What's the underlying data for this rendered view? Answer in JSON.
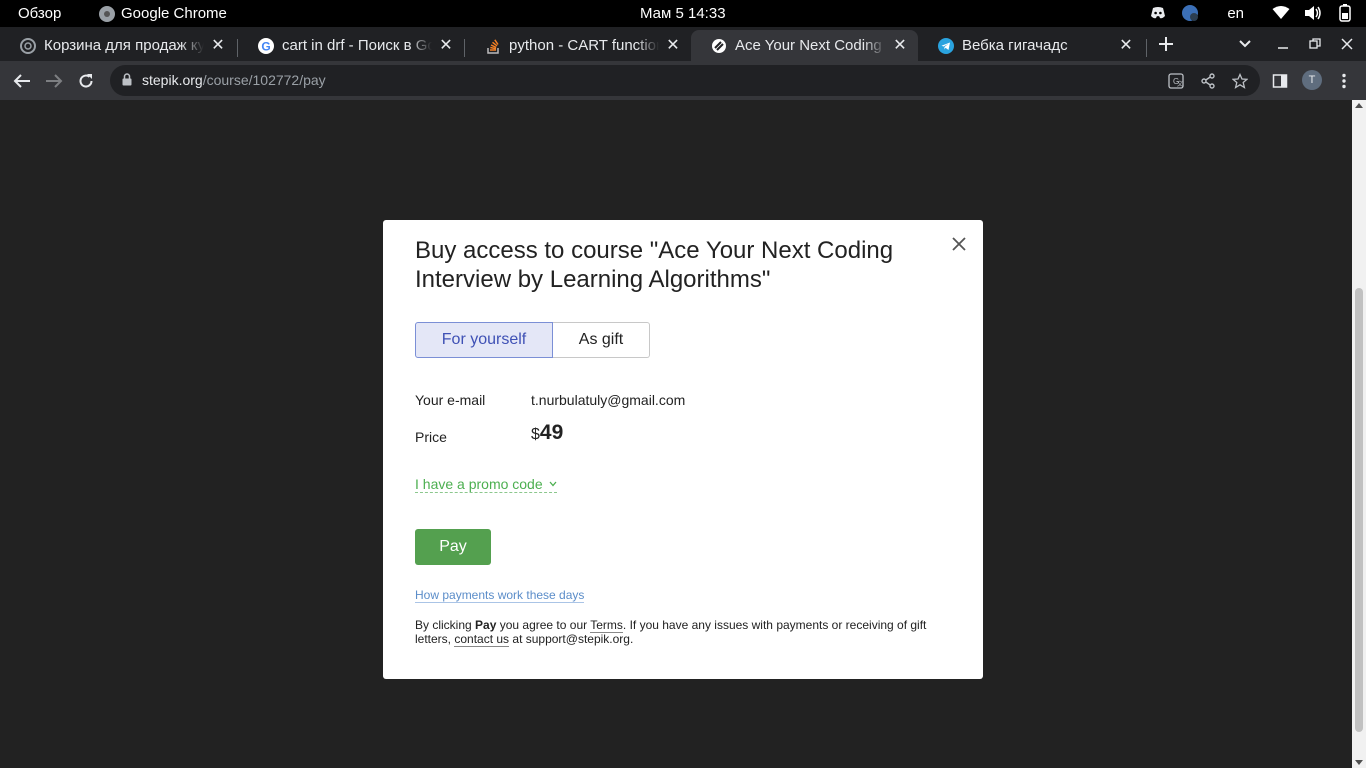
{
  "system_bar": {
    "overview": "Обзор",
    "app_name": "Google Chrome",
    "clock": "Мам 5  14:33",
    "lang": "en"
  },
  "tabs": [
    {
      "title": "Корзина для продаж ку",
      "favicon": "chatgpt-icon"
    },
    {
      "title": "cart in drf - Поиск в Goo",
      "favicon": "google-icon"
    },
    {
      "title": "python - CART functiona",
      "favicon": "stackoverflow-icon"
    },
    {
      "title": "Ace Your Next Coding In",
      "favicon": "stepik-icon",
      "active": true
    },
    {
      "title": "Вебка гигачадс",
      "favicon": "telegram-icon"
    }
  ],
  "omnibox": {
    "host": "stepik.org",
    "path": "/course/102772/pay"
  },
  "profile_initial": "T",
  "modal": {
    "title": "Buy access to course \"Ace Your Next Coding Interview by Learning Algorithms\"",
    "option_self": "For yourself",
    "option_gift": "As gift",
    "email_label": "Your e-mail",
    "email_value": "t.nurbulatuly@gmail.com",
    "price_label": "Price",
    "price_currency": "$",
    "price_amount": "49",
    "promo_label": "I have a promo code",
    "pay_label": "Pay",
    "how_payments": "How payments work these days",
    "terms_1": "By clicking ",
    "terms_pay": "Pay",
    "terms_2": " you agree to our ",
    "terms_link": "Terms",
    "terms_3": ". If you have any issues with payments or receiving of gift letters, ",
    "contact_link": "contact us",
    "terms_4": " at support@stepik.org."
  },
  "colors": {
    "pay_button": "#54a04f",
    "promo_text": "#4caf50",
    "link": "#5b8dc9",
    "selected_option_bg": "#e4e7f7"
  }
}
